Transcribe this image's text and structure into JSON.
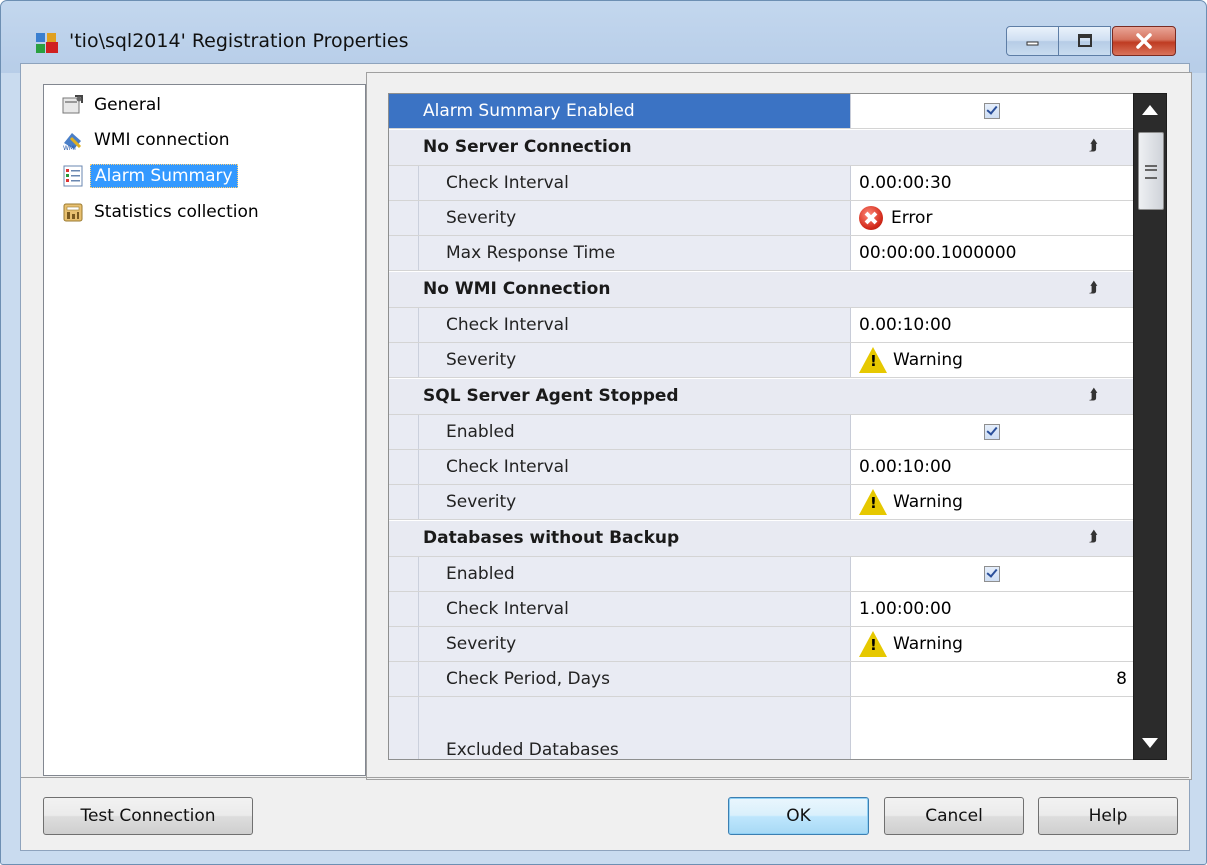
{
  "window": {
    "title": "'tio\\sql2014' Registration Properties"
  },
  "nav": {
    "items": [
      {
        "label": "General",
        "icon": "general-icon"
      },
      {
        "label": "WMI connection",
        "icon": "wmi-connection-icon"
      },
      {
        "label": "Alarm Summary",
        "icon": "alarm-summary-icon",
        "selected": true
      },
      {
        "label": "Statistics collection",
        "icon": "statistics-collection-icon"
      }
    ]
  },
  "grid": {
    "top_row": {
      "label": "Alarm Summary Enabled",
      "checked": true
    },
    "categories": [
      {
        "name": "No Server Connection",
        "rows": [
          {
            "label": "Check Interval",
            "value": "0.00:00:30"
          },
          {
            "label": "Severity",
            "value": "Error",
            "icon": "error-icon"
          },
          {
            "label": "Max Response Time",
            "value": "00:00:00.1000000"
          }
        ]
      },
      {
        "name": "No WMI Connection",
        "rows": [
          {
            "label": "Check Interval",
            "value": "0.00:10:00"
          },
          {
            "label": "Severity",
            "value": "Warning",
            "icon": "warning-icon"
          }
        ]
      },
      {
        "name": "SQL Server Agent Stopped",
        "rows": [
          {
            "label": "Enabled",
            "checked": true
          },
          {
            "label": "Check Interval",
            "value": "0.00:10:00"
          },
          {
            "label": "Severity",
            "value": "Warning",
            "icon": "warning-icon"
          }
        ]
      },
      {
        "name": "Databases without Backup",
        "rows": [
          {
            "label": "Enabled",
            "checked": true
          },
          {
            "label": "Check Interval",
            "value": "1.00:00:00"
          },
          {
            "label": "Severity",
            "value": "Warning",
            "icon": "warning-icon"
          },
          {
            "label": "Check Period, Days",
            "value": "8"
          },
          {
            "label": "Excluded Databases",
            "value": ""
          }
        ]
      }
    ]
  },
  "buttons": {
    "test_connection": "Test Connection",
    "ok": "OK",
    "cancel": "Cancel",
    "help": "Help"
  },
  "colors": {
    "selection": "#3399ff",
    "top_row_highlight": "#3b73c4",
    "close_button": "#c7452b"
  }
}
